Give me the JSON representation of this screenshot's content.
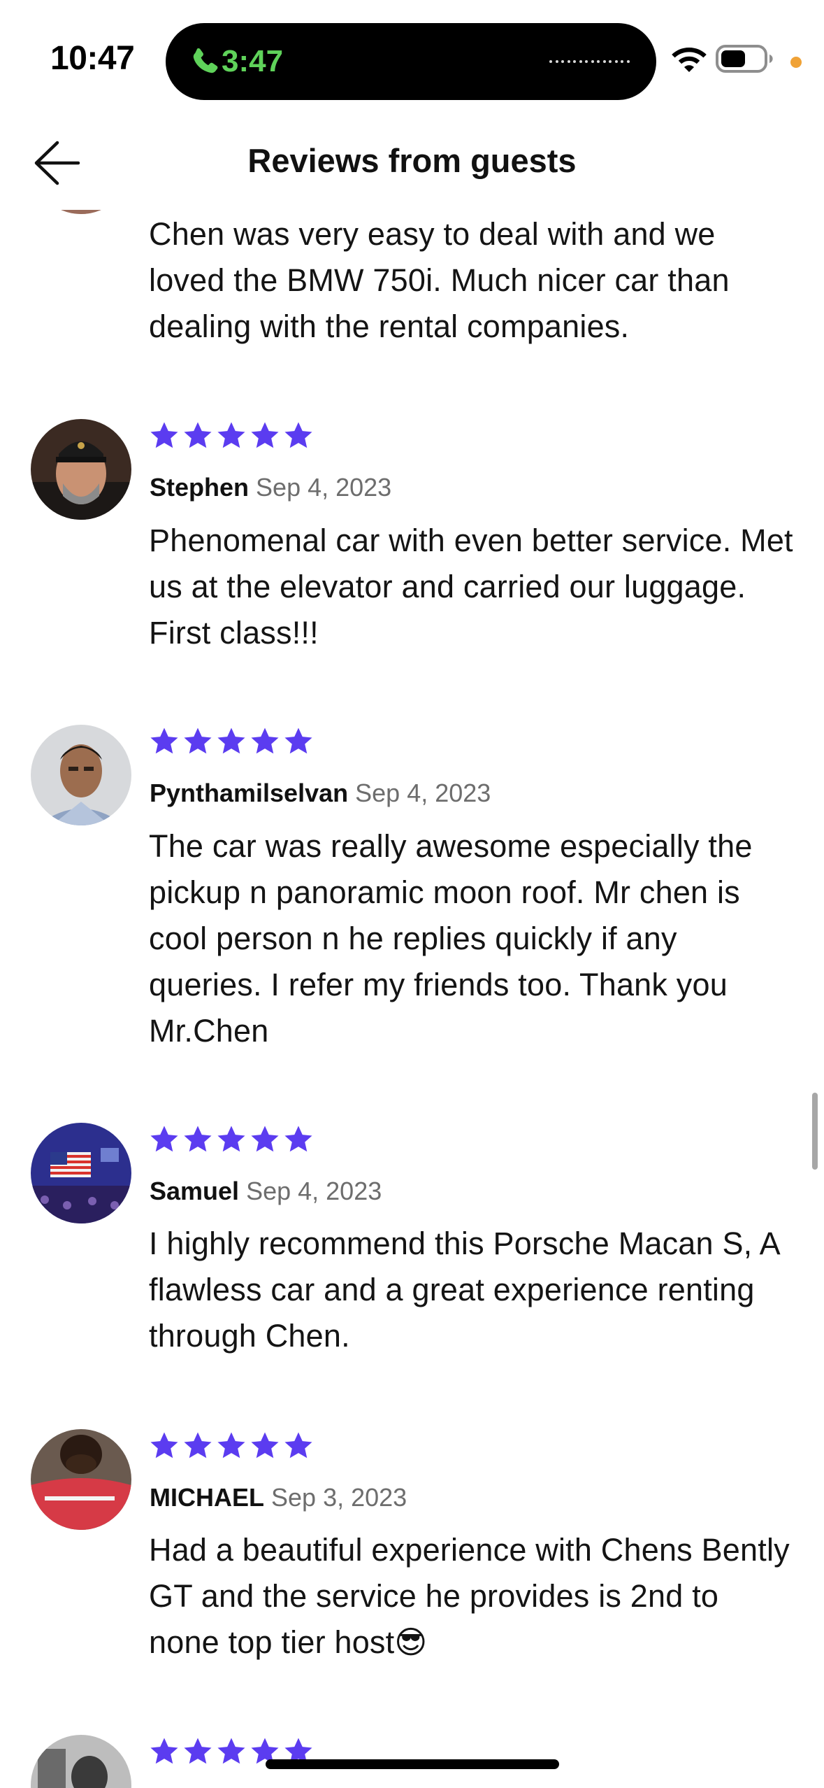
{
  "status_bar": {
    "time": "10:47",
    "call_duration": "3:47",
    "call_color": "#5fd25a",
    "privacy_dot_color": "#f0a236",
    "icons": [
      "phone-icon",
      "wifi-icon",
      "battery-icon"
    ]
  },
  "header": {
    "title": "Reviews from guests",
    "back_icon": "arrow-left-icon"
  },
  "accent_color": "#5b3cf0",
  "reviews": [
    {
      "name": "",
      "date": "",
      "rating": 5,
      "text": "Chen was very easy to deal with and we loved the BMW 750i. Much nicer car than dealing with the rental companies."
    },
    {
      "name": "Stephen",
      "date": "Sep 4, 2023",
      "rating": 5,
      "text": "Phenomenal car with even better service. Met us at the elevator and carried our luggage. First class!!!"
    },
    {
      "name": "Pynthamilselvan",
      "date": "Sep 4, 2023",
      "rating": 5,
      "text": "The car was really awesome especially the pickup n panoramic moon roof. Mr chen is cool person n he replies quickly if any queries. I refer my friends too. Thank you Mr.Chen"
    },
    {
      "name": "Samuel",
      "date": "Sep 4, 2023",
      "rating": 5,
      "text": "I highly recommend this Porsche Macan S,  A flawless car and a great experience renting through Chen."
    },
    {
      "name": "MICHAEL",
      "date": "Sep 3, 2023",
      "rating": 5,
      "text": "Had a beautiful experience with Chens Bently GT and the service he provides is 2nd to none top tier host😎"
    },
    {
      "name": "",
      "date": "",
      "rating": 5,
      "text": ""
    }
  ]
}
